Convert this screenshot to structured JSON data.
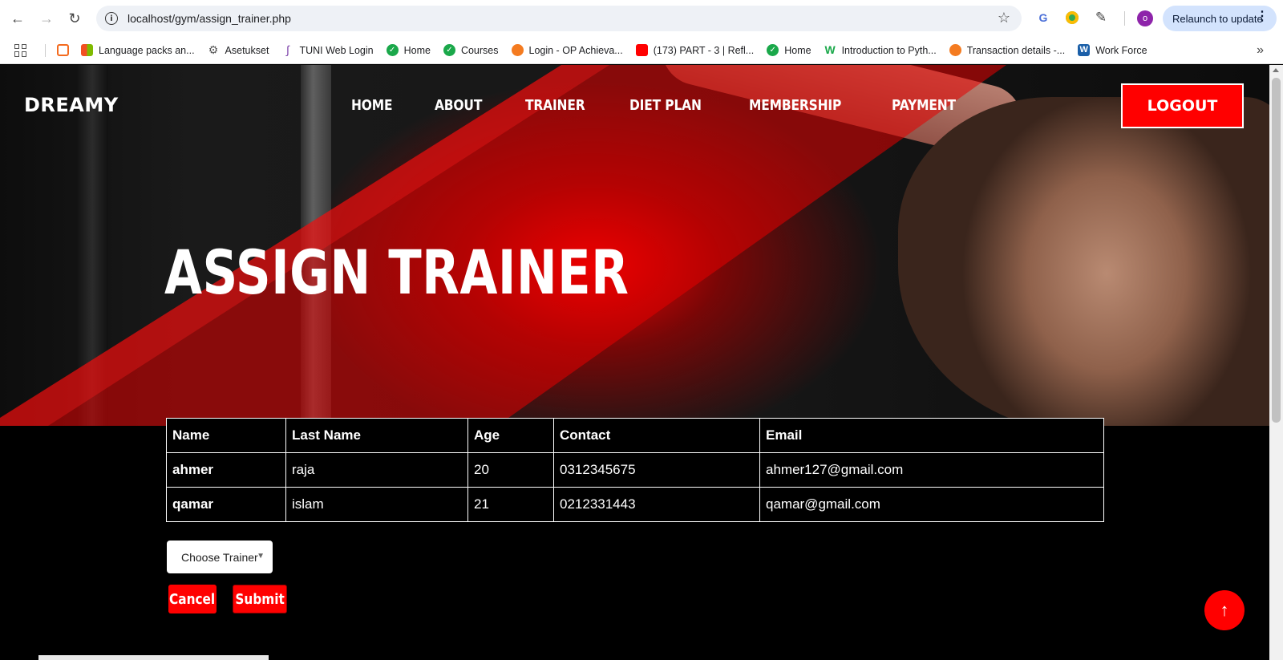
{
  "browser": {
    "url": "localhost/gym/assign_trainer.php",
    "relaunch_label": "Relaunch to update",
    "avatar_letter": "o",
    "bookmarks": [
      {
        "label": "",
        "icon": "xampp-icon"
      },
      {
        "label": "Language packs an...",
        "icon": "microsoft-icon"
      },
      {
        "label": "Asetukset",
        "icon": "gear-icon"
      },
      {
        "label": "TUNI Web Login",
        "icon": "tuni-icon"
      },
      {
        "label": "Home",
        "icon": "check-circle-icon"
      },
      {
        "label": "Courses",
        "icon": "check-circle-icon"
      },
      {
        "label": "Login - OP Achieva...",
        "icon": "op-icon"
      },
      {
        "label": "(173) PART - 3 | Refl...",
        "icon": "youtube-icon"
      },
      {
        "label": "Home",
        "icon": "check-circle-icon"
      },
      {
        "label": "Introduction to Pyth...",
        "icon": "w-icon"
      },
      {
        "label": "Transaction details -...",
        "icon": "op-icon"
      },
      {
        "label": "Work Force",
        "icon": "w-blue-icon"
      }
    ]
  },
  "site": {
    "logo": "DREAMY",
    "nav": [
      "HOME",
      "ABOUT",
      "TRAINER",
      "DIET PLAN",
      "MEMBERSHIP",
      "PAYMENT"
    ],
    "logout_label": "LOGOUT",
    "hero_title": "ASSIGN TRAINER",
    "accent_color": "#ff0000"
  },
  "table": {
    "headers": [
      "Name",
      "Last Name",
      "Age",
      "Contact",
      "Email"
    ],
    "rows": [
      [
        "ahmer",
        "raja",
        "20",
        "0312345675",
        "ahmer127@gmail.com"
      ],
      [
        "qamar",
        "islam",
        "21",
        "0212331443",
        "qamar@gmail.com"
      ]
    ]
  },
  "form": {
    "select_label": "Choose Trainer",
    "cancel_label": "Cancel",
    "submit_label": "Submit"
  }
}
